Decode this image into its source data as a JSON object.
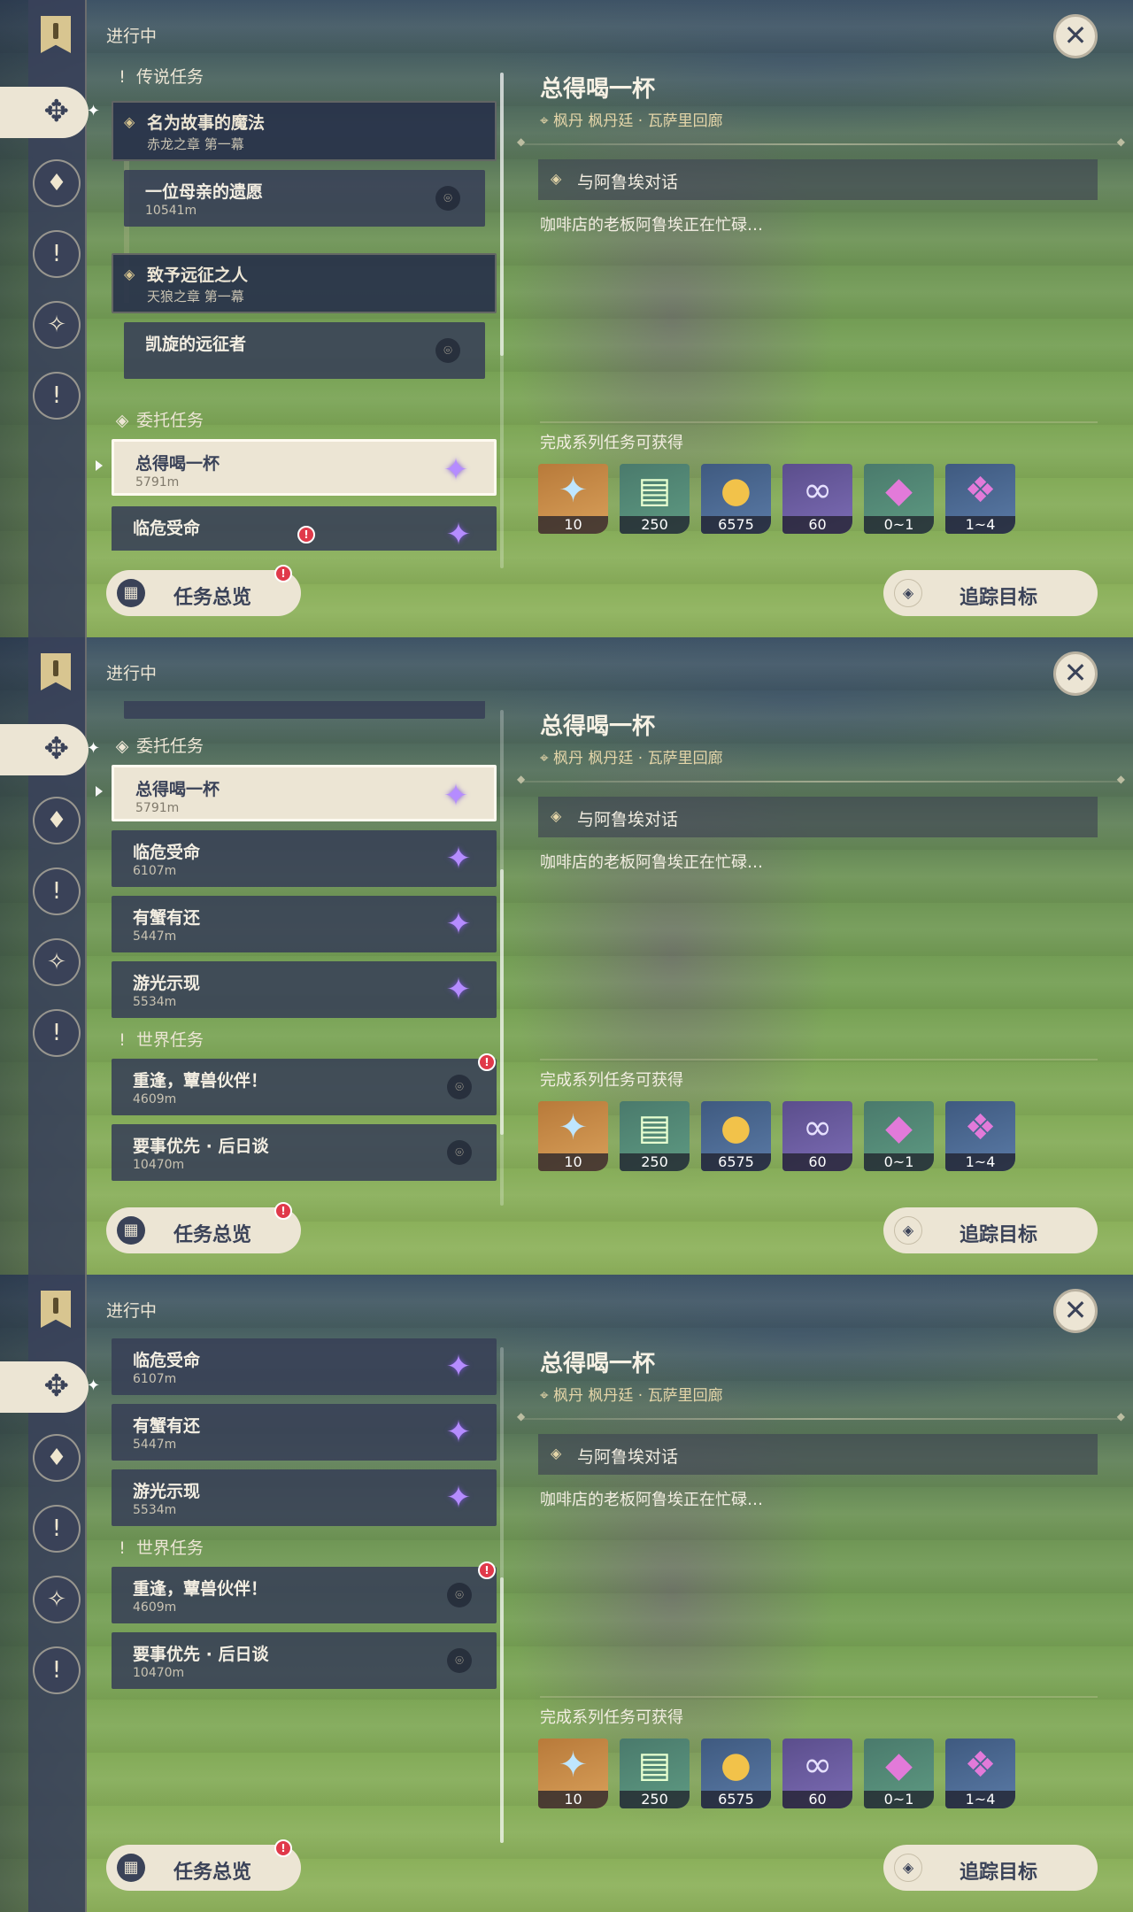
{
  "status": "进行中",
  "detail": {
    "title": "总得喝一杯",
    "location": "枫丹 枫丹廷 · 瓦萨里回廊",
    "objective": "与阿鲁埃对话",
    "description": "咖啡店的老板阿鲁埃正在忙碌…",
    "rewards_heading": "完成系列任务可获得",
    "rewards": [
      {
        "icon": "primogem-icon",
        "qty": "10"
      },
      {
        "icon": "adventure-exp-icon",
        "qty": "250"
      },
      {
        "icon": "mora-icon",
        "qty": "6575"
      },
      {
        "icon": "fellowship-icon",
        "qty": "60"
      },
      {
        "icon": "crystal-small-icon",
        "qty": "0~1"
      },
      {
        "icon": "crystal-large-icon",
        "qty": "1~4"
      }
    ]
  },
  "buttons": {
    "overview": "任务总览",
    "track": "追踪目标"
  },
  "sections": {
    "legend": "传说任务",
    "commission": "委托任务",
    "world": "世界任务"
  },
  "quests": {
    "magic": {
      "title": "名为故事的魔法",
      "sub": "赤龙之章 第一幕"
    },
    "mother": {
      "title": "一位母亲的遗愿",
      "sub": "10541m"
    },
    "conqueror": {
      "title": "致予远征之人",
      "sub": "天狼之章 第一幕"
    },
    "triumph": {
      "title": "凯旋的远征者",
      "sub": ""
    },
    "drink": {
      "title": "总得喝一杯",
      "sub": "5791m"
    },
    "danger": {
      "title": "临危受命",
      "sub": "6107m"
    },
    "crab": {
      "title": "有蟹有还",
      "sub": "5447m"
    },
    "light": {
      "title": "游光示现",
      "sub": "5534m"
    },
    "reunion": {
      "title": "重逢，蕈兽伙伴！",
      "sub": "4609m"
    },
    "priority": {
      "title": "要事优先 · 后日谈",
      "sub": "10470m"
    }
  }
}
